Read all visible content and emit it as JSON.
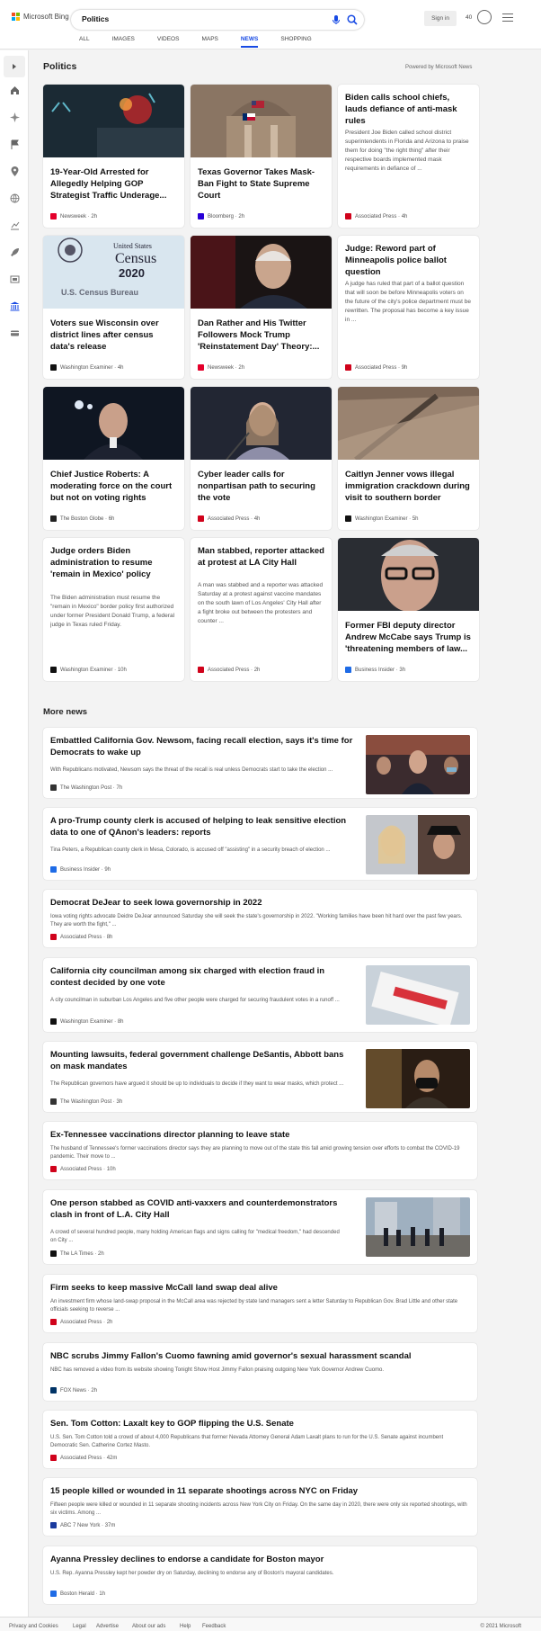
{
  "brand": {
    "name": "Microsoft Bing"
  },
  "search": {
    "query": "Politics"
  },
  "header": {
    "signin": "Sign in",
    "points": "40"
  },
  "tabs": [
    "ALL",
    "IMAGES",
    "VIDEOS",
    "MAPS",
    "NEWS",
    "SHOPPING"
  ],
  "active_tab": "NEWS",
  "page": {
    "title": "Politics",
    "powered_by": "Powered by Microsoft News",
    "more_news": "More news"
  },
  "cards": [
    {
      "title": "19-Year-Old Arrested for Allegedly Helping GOP Strategist Traffic Underage...",
      "source": "Newsweek",
      "time": "2h"
    },
    {
      "title": "Texas Governor Takes Mask-Ban Fight to State Supreme Court",
      "source": "Bloomberg",
      "time": "2h"
    },
    {
      "title": "Biden calls school chiefs, lauds defiance of anti-mask rules",
      "snippet": "President Joe Biden called school district superintendents in Florida and Arizona to praise them for doing \"the right thing\" after their respective boards implemented mask requirements in defiance of ...",
      "source": "Associated Press",
      "time": "4h"
    },
    {
      "title": "Voters sue Wisconsin over district lines after census data's release",
      "source": "Washington Examiner",
      "time": "4h"
    },
    {
      "title": "Dan Rather and His Twitter Followers Mock Trump 'Reinstatement Day' Theory:...",
      "source": "Newsweek",
      "time": "2h"
    },
    {
      "title": "Judge: Reword part of Minneapolis police ballot question",
      "snippet": "A judge has ruled that part of a ballot question that will soon be before Minneapolis voters on the future of the city's police department must be rewritten. The proposal has become a key issue in ...",
      "source": "Associated Press",
      "time": "9h"
    },
    {
      "title": "Chief Justice Roberts: A moderating force on the court but not on voting rights",
      "source": "The Boston Globe",
      "time": "6h"
    },
    {
      "title": "Cyber leader calls for nonpartisan path to securing the vote",
      "source": "Associated Press",
      "time": "4h"
    },
    {
      "title": "Caitlyn Jenner vows illegal immigration crackdown during visit to southern border",
      "source": "Washington Examiner",
      "time": "5h"
    },
    {
      "title": "Judge orders Biden administration to resume 'remain in Mexico' policy",
      "snippet": "The Biden administration must resume the \"remain in Mexico\" border policy first authorized under former President Donald Trump, a federal judge in Texas ruled Friday.",
      "source": "Washington Examiner",
      "time": "10h"
    },
    {
      "title": "Man stabbed, reporter attacked at protest at LA City Hall",
      "snippet": "A man was stabbed and a reporter was attacked Saturday at a protest against vaccine mandates on the south lawn of Los Angeles' City Hall after a fight broke out between the protesters and counter ...",
      "source": "Associated Press",
      "time": "2h"
    },
    {
      "title": "Former FBI deputy director Andrew McCabe says Trump is 'threatening members of law...",
      "source": "Business Insider",
      "time": "3h"
    }
  ],
  "more": [
    {
      "title": "Embattled California Gov. Newsom, facing recall election, says it's time for Democrats to wake up",
      "snippet": "With Republicans motivated, Newsom says the threat of the recall is real unless Democrats start to take the election ...",
      "source": "The Washington Post",
      "time": "7h"
    },
    {
      "title": "A pro-Trump county clerk is accused of helping to leak sensitive election data to one of QAnon's leaders: reports",
      "snippet": "Tina Peters, a Republican county clerk in Mesa, Colorado, is accused off \"assisting\" in a security breach of election ...",
      "source": "Business Insider",
      "time": "9h"
    },
    {
      "title": "Democrat DeJear to seek Iowa governorship in 2022",
      "snippet": "Iowa voting rights advocate Deidre DeJear announced Saturday she will seek the state's governorship in 2022. \"Working families have been hit hard over the past few years. They are worth the fight,\" ...",
      "source": "Associated Press",
      "time": "8h"
    },
    {
      "title": "California city councilman among six charged with election fraud in contest decided by one vote",
      "snippet": "A city councilman in suburban Los Angeles and five other people were charged for securing fraudulent votes in a runoff ...",
      "source": "Washington Examiner",
      "time": "8h"
    },
    {
      "title": "Mounting lawsuits, federal government challenge DeSantis, Abbott bans on mask mandates",
      "snippet": "The Republican governors have argued it should be up to individuals to decide if they want to wear masks, which protect ...",
      "source": "The Washington Post",
      "time": "3h"
    },
    {
      "title": "Ex-Tennessee vaccinations director planning to leave state",
      "snippet": "The husband of Tennessee's former vaccinations director says they are planning to move out of the state this fall amid growing tension over efforts to combat the COVID-19 pandemic. Their move to ...",
      "source": "Associated Press",
      "time": "10h"
    },
    {
      "title": "One person stabbed as COVID anti-vaxxers and counterdemonstrators clash in front of L.A. City Hall",
      "snippet": "A crowd of several hundred people, many holding American flags and signs calling for \"medical freedom,\" had descended on City ...",
      "source": "The LA Times",
      "time": "2h"
    },
    {
      "title": "Firm seeks to keep massive McCall land swap deal alive",
      "snippet": "An investment firm whose land-swap proposal in the McCall area was rejected by state land managers sent a letter Saturday to Republican Gov. Brad Little and other state officials seeking to reverse ...",
      "source": "Associated Press",
      "time": "2h"
    },
    {
      "title": "NBC scrubs Jimmy Fallon's Cuomo fawning amid governor's sexual harassment scandal",
      "snippet": "NBC has removed a video from its website showing Tonight Show Host Jimmy Fallon praising outgoing New York Governor Andrew Cuomo.",
      "source": "FOX News",
      "time": "2h"
    },
    {
      "title": "Sen. Tom Cotton: Laxalt key to GOP flipping the U.S. Senate",
      "snippet": "U.S. Sen. Tom Cotton told a crowd of about 4,000 Republicans that former Nevada Attorney General Adam Laxalt plans to run for the U.S. Senate against incumbent Democratic Sen. Catherine Cortez Masto.",
      "source": "Associated Press",
      "time": "42m"
    },
    {
      "title": "15 people killed or wounded in 11 separate shootings across NYC on Friday",
      "snippet": "Fifteen people were killed or wounded in 11 separate shooting incidents across New York City on Friday. On the same day in 2020, there were only six reported shootings, with six victims. Among ...",
      "source": "ABC 7 New York",
      "time": "37m"
    },
    {
      "title": "Ayanna Pressley declines to endorse a candidate for Boston mayor",
      "snippet": "U.S. Rep. Ayanna Pressley kept her powder dry on Saturday, declining to endorse any of Boston's mayoral candidates.",
      "source": "Boston Herald",
      "time": "1h"
    }
  ],
  "footer": {
    "links": [
      "Privacy and Cookies",
      "Legal",
      "Advertise",
      "About our ads",
      "Help",
      "Feedback"
    ],
    "copyright": "© 2021 Microsoft"
  },
  "colors": {
    "accent": "#174ae4",
    "ap": "#d0021b",
    "newsweek": "#e4002b",
    "bloomberg": "#2800d7"
  }
}
